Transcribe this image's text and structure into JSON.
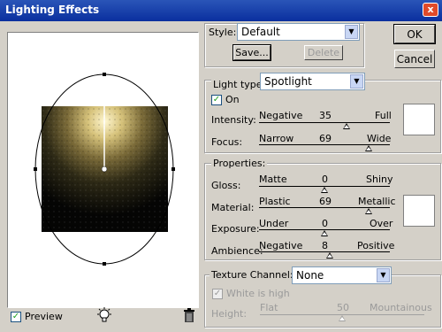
{
  "window": {
    "title": "Lighting Effects",
    "close_glyph": "x"
  },
  "buttons": {
    "ok": "OK",
    "cancel": "Cancel",
    "save": "Save...",
    "delete": "Delete"
  },
  "style": {
    "label": "Style:",
    "value": "Default"
  },
  "light_type": {
    "label": "Light type:",
    "value": "Spotlight",
    "on_label": "On",
    "on_checked": true
  },
  "intensity": {
    "label": "Intensity:",
    "min": "Negative",
    "max": "Full",
    "value": "35"
  },
  "focus": {
    "label": "Focus:",
    "min": "Narrow",
    "max": "Wide",
    "value": "69"
  },
  "properties": {
    "label": "Properties:",
    "gloss": {
      "label": "Gloss:",
      "min": "Matte",
      "max": "Shiny",
      "value": "0"
    },
    "material": {
      "label": "Material:",
      "min": "Plastic",
      "max": "Metallic",
      "value": "69"
    },
    "exposure": {
      "label": "Exposure:",
      "min": "Under",
      "max": "Over",
      "value": "0"
    },
    "ambience": {
      "label": "Ambience:",
      "min": "Negative",
      "max": "Positive",
      "value": "8"
    }
  },
  "texture": {
    "label": "Texture Channel:",
    "value": "None",
    "white_is_high": "White is high",
    "height": {
      "label": "Height:",
      "min": "Flat",
      "max": "Mountainous",
      "value": "50"
    }
  },
  "preview": {
    "label": "Preview",
    "checked": true
  },
  "icons": {
    "light_bulb": "light-bulb-icon",
    "trash": "trash-icon"
  },
  "colors": {
    "title_bar": "#0a2f9e",
    "dialog_bg": "#d4d0c8",
    "swatch": "#ffffff"
  }
}
